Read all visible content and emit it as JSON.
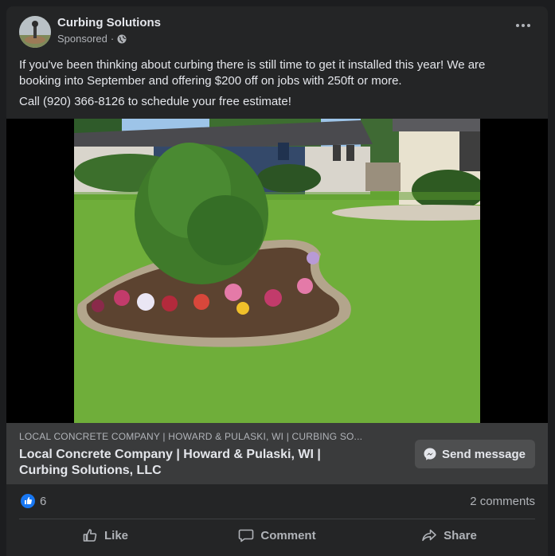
{
  "post": {
    "page_name": "Curbing Solutions",
    "sponsored": "Sponsored",
    "separator": "·",
    "body_paragraph_1": "If you've been thinking about curbing there is still time to get it installed this year! We are booking into September and offering $200 off on jobs with 250ft or more.",
    "body_paragraph_2": "Call (920) 366-8126 to schedule your free estimate!"
  },
  "link_preview": {
    "domain_line": "LOCAL CONCRETE COMPANY | HOWARD & PULASKI, WI | CURBING SO...",
    "title_line_1": "Local Concrete Company | Howard & Pulaski, WI |",
    "title_line_2": "Curbing Solutions, LLC",
    "cta_label": "Send message"
  },
  "engagement": {
    "likes": "6",
    "comments": "2 comments"
  },
  "actions": {
    "like_label": "Like",
    "comment_label": "Comment",
    "share_label": "Share"
  },
  "colors": {
    "background": "#1c1d1f",
    "card": "#242526",
    "link_bar": "#3a3b3c",
    "like_blue": "#1877f2",
    "text_primary": "#e4e6eb",
    "text_secondary": "#b0b3b8"
  },
  "icons": [
    "more-options-icon",
    "globe-icon",
    "messenger-icon",
    "like-reaction-icon",
    "thumbs-up-icon",
    "comment-icon",
    "share-icon"
  ]
}
